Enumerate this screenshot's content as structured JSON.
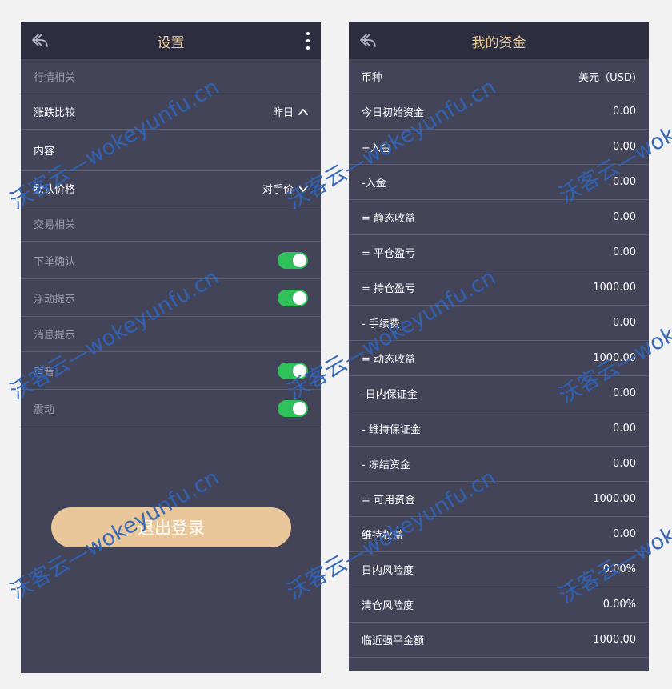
{
  "settings_screen": {
    "title": "设置",
    "section_market": "行情相关",
    "change_compare": {
      "label": "涨跌比较",
      "value": "昨日"
    },
    "content_label": "内容",
    "default_price": {
      "label": "默认价格",
      "value": "对手价"
    },
    "section_trade": "交易相关",
    "order_confirm": {
      "label": "下单确认",
      "on": true
    },
    "float_tip": {
      "label": "浮动提示",
      "on": true
    },
    "message_tip": {
      "label": "消息提示"
    },
    "sound": {
      "label": "声音",
      "on": true
    },
    "vibrate": {
      "label": "震动",
      "on": true
    },
    "logout_label": "退出登录"
  },
  "funds_screen": {
    "title": "我的资金",
    "rows": [
      {
        "label": "币种",
        "value": "美元（USD)"
      },
      {
        "label": "今日初始资金",
        "value": "0.00"
      },
      {
        "label": "+入金",
        "value": "0.00"
      },
      {
        "label": "-入金",
        "value": "0.00"
      },
      {
        "label": "= 静态收益",
        "value": "0.00"
      },
      {
        "label": "= 平仓盈亏",
        "value": "0.00"
      },
      {
        "label": "= 持仓盈亏",
        "value": "1000.00"
      },
      {
        "label": "- 手续费",
        "value": "0.00"
      },
      {
        "label": "= 动态收益",
        "value": "1000.00"
      },
      {
        "label": "-日内保证金",
        "value": "0.00"
      },
      {
        "label": "- 维持保证金",
        "value": "0.00"
      },
      {
        "label": "- 冻结资金",
        "value": "0.00"
      },
      {
        "label": "= 可用资金",
        "value": "1000.00"
      },
      {
        "label": "维持权益",
        "value": "0.00"
      },
      {
        "label": "日内风险度",
        "value": "0.00%"
      },
      {
        "label": "清仓风险度",
        "value": "0.00%"
      },
      {
        "label": "临近强平金额",
        "value": "1000.00"
      }
    ]
  },
  "watermark": {
    "text": "沃客云—wokeyunfu.cn"
  },
  "colors": {
    "background": "#434458",
    "header": "#2c2d3e",
    "accent": "#e8c79a",
    "toggle_on": "#2fc15a",
    "watermark": "#2f63b8"
  }
}
